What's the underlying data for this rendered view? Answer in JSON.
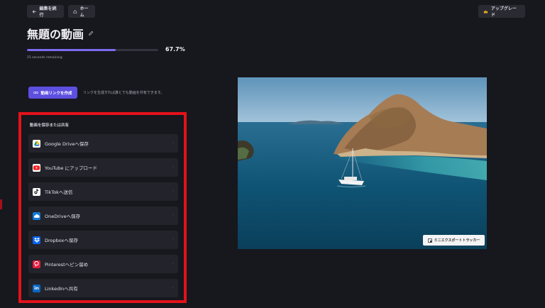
{
  "topbar": {
    "back_label": "編集を続行",
    "home_label": "ホーム",
    "upgrade_label": "アップグレード"
  },
  "video": {
    "title": "無題の動画",
    "progress_percent": 67.7,
    "progress_label": "67.7%",
    "remaining": "15 seconds remaining"
  },
  "link": {
    "button_label": "動画リンクを作成",
    "note": "リンクを生成すれば誰とでも動画を共有できます。"
  },
  "share": {
    "heading": "動画を保存または共有",
    "items": [
      {
        "label": "Google Driveへ保存",
        "icon": "google-drive-icon",
        "color": "#ffffff"
      },
      {
        "label": "YouTube にアップロード",
        "icon": "youtube-icon",
        "color": "#ff1f1f"
      },
      {
        "label": "TikTokへ送信",
        "icon": "tiktok-icon",
        "color": "#ffffff"
      },
      {
        "label": "OneDriveへ保存",
        "icon": "onedrive-icon",
        "color": "#1479d6"
      },
      {
        "label": "Dropboxへ保存",
        "icon": "dropbox-icon",
        "color": "#0a63f0"
      },
      {
        "label": "Pinterestへピン留め",
        "icon": "pinterest-icon",
        "color": "#e21b3c"
      },
      {
        "label": "LinkedInへ共有",
        "icon": "linkedin-icon",
        "color": "#0a66c2"
      }
    ]
  },
  "preview": {
    "export_tracker_label": "ミニエクスポートトラッカー"
  },
  "colors": {
    "accent": "#5d4fe0",
    "progress": "#7b6cf0",
    "highlight_border": "#e3121a",
    "upgrade_icon": "#f2b01e"
  }
}
